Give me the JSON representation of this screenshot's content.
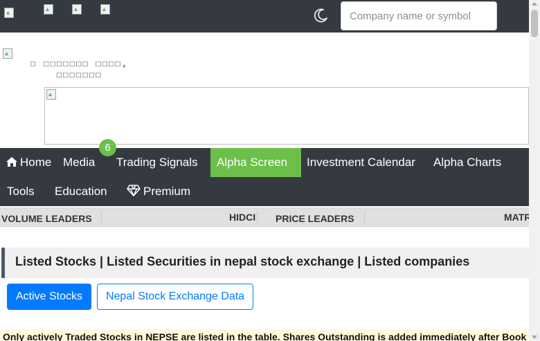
{
  "search": {
    "placeholder": "Company name or symbol"
  },
  "tagline": "☐ ☐☐☐☐☐☐☐ ☐☐☐☐, ☐☐☐☐☐☐☐",
  "nav": {
    "home": "Home",
    "media": "Media",
    "media_badge": "6",
    "trading_signals": "Trading Signals",
    "alpha_screen": "Alpha Screen",
    "investment_calendar": "Investment Calendar",
    "alpha_charts": "Alpha Charts",
    "tools": "Tools",
    "education": "Education",
    "premium": "Premium"
  },
  "ticker": {
    "volume_leaders": "VOLUME LEADERS",
    "hidci": "HIDCI",
    "price_leaders": "PRICE LEADERS",
    "matr": "MATR"
  },
  "heading": "Listed Stocks | Listed Securities in nepal stock exchange | Listed companies",
  "buttons": {
    "active_stocks": "Active Stocks",
    "nepse_data": "Nepal Stock Exchange Data"
  },
  "notice": "Only actively Traded Stocks in NEPSE are listed in the table. Shares Outstanding is added immediately after Book",
  "colors": {
    "navbar": "#343a40",
    "accent_green": "#6cc04a",
    "primary_blue": "#007bff"
  }
}
